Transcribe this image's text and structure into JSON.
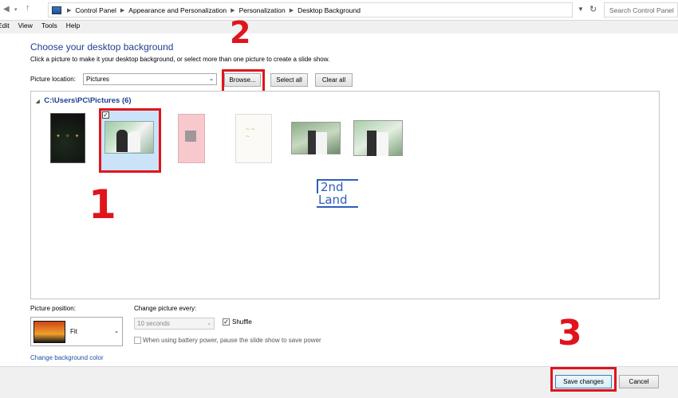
{
  "address_bar": {
    "crumbs": [
      "Control Panel",
      "Appearance and Personalization",
      "Personalization",
      "Desktop Background"
    ],
    "search_placeholder": "Search Control Panel"
  },
  "menu": [
    "Edit",
    "View",
    "Tools",
    "Help"
  ],
  "main": {
    "title": "Choose your desktop background",
    "subtitle": "Click a picture to make it your desktop background, or select more than one picture to create a slide show.",
    "location_label": "Picture location:",
    "location_value": "Pictures",
    "browse_label": "Browse...",
    "select_all_label": "Select all",
    "clear_all_label": "Clear all",
    "folder": "C:\\Users\\PC\\Pictures (6)",
    "watermark": [
      "2nd",
      "Land"
    ]
  },
  "options": {
    "position_label": "Picture position:",
    "position_value": "Fit",
    "every_label": "Change picture every:",
    "every_value": "10 seconds",
    "shuffle_label": "Shuffle",
    "shuffle_checked": true,
    "battery_label": "When using battery power, pause the slide show to save power",
    "battery_checked": false,
    "bg_color_link": "Change background color"
  },
  "footer": {
    "save_label": "Save changes",
    "cancel_label": "Cancel"
  },
  "annotations": [
    "1",
    "2",
    "3"
  ],
  "colors": {
    "annotation": "#e0141c",
    "title": "#1e3f8e",
    "selection": "#cbe3f8"
  }
}
